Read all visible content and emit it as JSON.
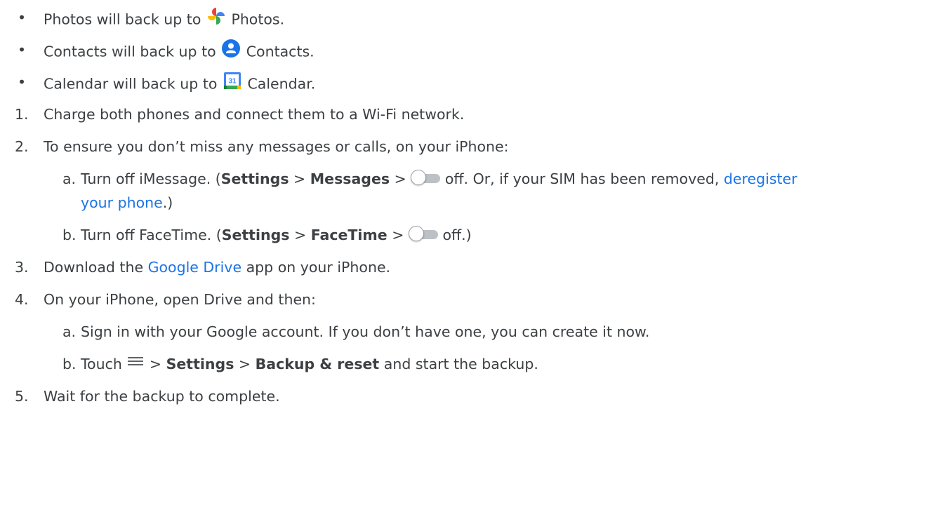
{
  "bullets": [
    {
      "before": "Photos will back up to",
      "app_icon": "google-photos-icon",
      "after": "Photos."
    },
    {
      "before": "Contacts will back up to",
      "app_icon": "google-contacts-icon",
      "after": "Contacts."
    },
    {
      "before": "Calendar will back up to",
      "app_icon": "google-calendar-icon",
      "icon_text": "31",
      "after": "Calendar."
    }
  ],
  "bullet_char": "•",
  "steps": [
    {
      "num": "1.",
      "text": "Charge both phones and connect them to a Wi-Fi network."
    },
    {
      "num": "2.",
      "text": "To ensure you don’t miss any messages or calls, on your iPhone:",
      "substeps": [
        {
          "letter": "a.",
          "t1": "Turn off iMessage. (",
          "b1": "Settings",
          "sep1": ">",
          "b2": "Messages",
          "sep2": ">",
          "t2": "off. Or, if your SIM has been removed,",
          "link_line1": "deregister",
          "link_line2": "your phone",
          "t3": ".)"
        },
        {
          "letter": "b.",
          "t1": "Turn off FaceTime. (",
          "b1": "Settings",
          "sep1": ">",
          "b2": "FaceTime",
          "sep2": ">",
          "t2": "off.)"
        }
      ]
    },
    {
      "num": "3.",
      "t1": "Download the",
      "link": "Google Drive",
      "t2": "app on your iPhone."
    },
    {
      "num": "4.",
      "text": "On your iPhone, open Drive and then:",
      "substeps": [
        {
          "letter": "a.",
          "text": "Sign in with your Google account. If you don’t have one, you can create it now."
        },
        {
          "letter": "b.",
          "t1": "Touch",
          "menu_icon": "menu-icon",
          "sep1": ">",
          "b1": "Settings",
          "sep2": ">",
          "b2": "Backup & reset",
          "t2": "and start the backup."
        }
      ]
    },
    {
      "num": "5.",
      "text": "Wait for the backup to complete."
    }
  ],
  "colors": {
    "text": "#3c4043",
    "link": "#1a73e8",
    "toggle_track": "#bdc1c6"
  }
}
